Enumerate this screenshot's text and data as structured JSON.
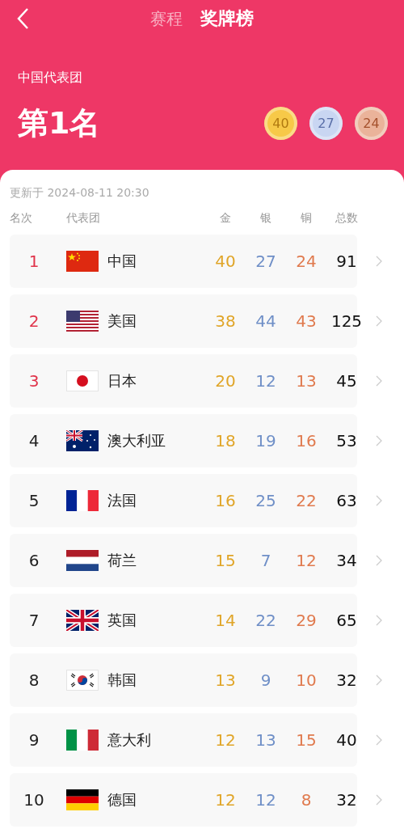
{
  "nav": {
    "tabs": [
      {
        "label": "赛程",
        "selected": false
      },
      {
        "label": "奖牌榜",
        "selected": true
      }
    ]
  },
  "summary": {
    "delegation": "中国代表团",
    "rank": "第1名",
    "medals": [
      {
        "kind": "gold",
        "count": "40"
      },
      {
        "kind": "silver",
        "count": "27"
      },
      {
        "kind": "bronze",
        "count": "24"
      }
    ]
  },
  "updated": "更新于 2024-08-11 20:30",
  "table": {
    "columns": [
      "名次",
      "代表团",
      "金",
      "银",
      "铜",
      "总数"
    ],
    "rows": [
      {
        "rank": "1",
        "highlighted": true,
        "kind": "cn",
        "name": "中国",
        "gold": "40",
        "silver": "27",
        "bronze": "24",
        "total": "91"
      },
      {
        "rank": "2",
        "highlighted": true,
        "kind": "us",
        "name": "美国",
        "gold": "38",
        "silver": "44",
        "bronze": "43",
        "total": "125"
      },
      {
        "rank": "3",
        "highlighted": true,
        "kind": "jp",
        "name": "日本",
        "gold": "20",
        "silver": "12",
        "bronze": "13",
        "total": "45"
      },
      {
        "rank": "4",
        "highlighted": false,
        "kind": "au",
        "name": "澳大利亚",
        "gold": "18",
        "silver": "19",
        "bronze": "16",
        "total": "53"
      },
      {
        "rank": "5",
        "highlighted": false,
        "kind": "fr",
        "name": "法国",
        "gold": "16",
        "silver": "25",
        "bronze": "22",
        "total": "63"
      },
      {
        "rank": "6",
        "highlighted": false,
        "kind": "nl",
        "name": "荷兰",
        "gold": "15",
        "silver": "7",
        "bronze": "12",
        "total": "34"
      },
      {
        "rank": "7",
        "highlighted": false,
        "kind": "gb",
        "name": "英国",
        "gold": "14",
        "silver": "22",
        "bronze": "29",
        "total": "65"
      },
      {
        "rank": "8",
        "highlighted": false,
        "kind": "kr",
        "name": "韩国",
        "gold": "13",
        "silver": "9",
        "bronze": "10",
        "total": "32"
      },
      {
        "rank": "9",
        "highlighted": false,
        "kind": "it",
        "name": "意大利",
        "gold": "12",
        "silver": "13",
        "bronze": "15",
        "total": "40"
      },
      {
        "rank": "10",
        "highlighted": false,
        "kind": "de",
        "name": "德国",
        "gold": "12",
        "silver": "12",
        "bronze": "8",
        "total": "32"
      }
    ]
  }
}
